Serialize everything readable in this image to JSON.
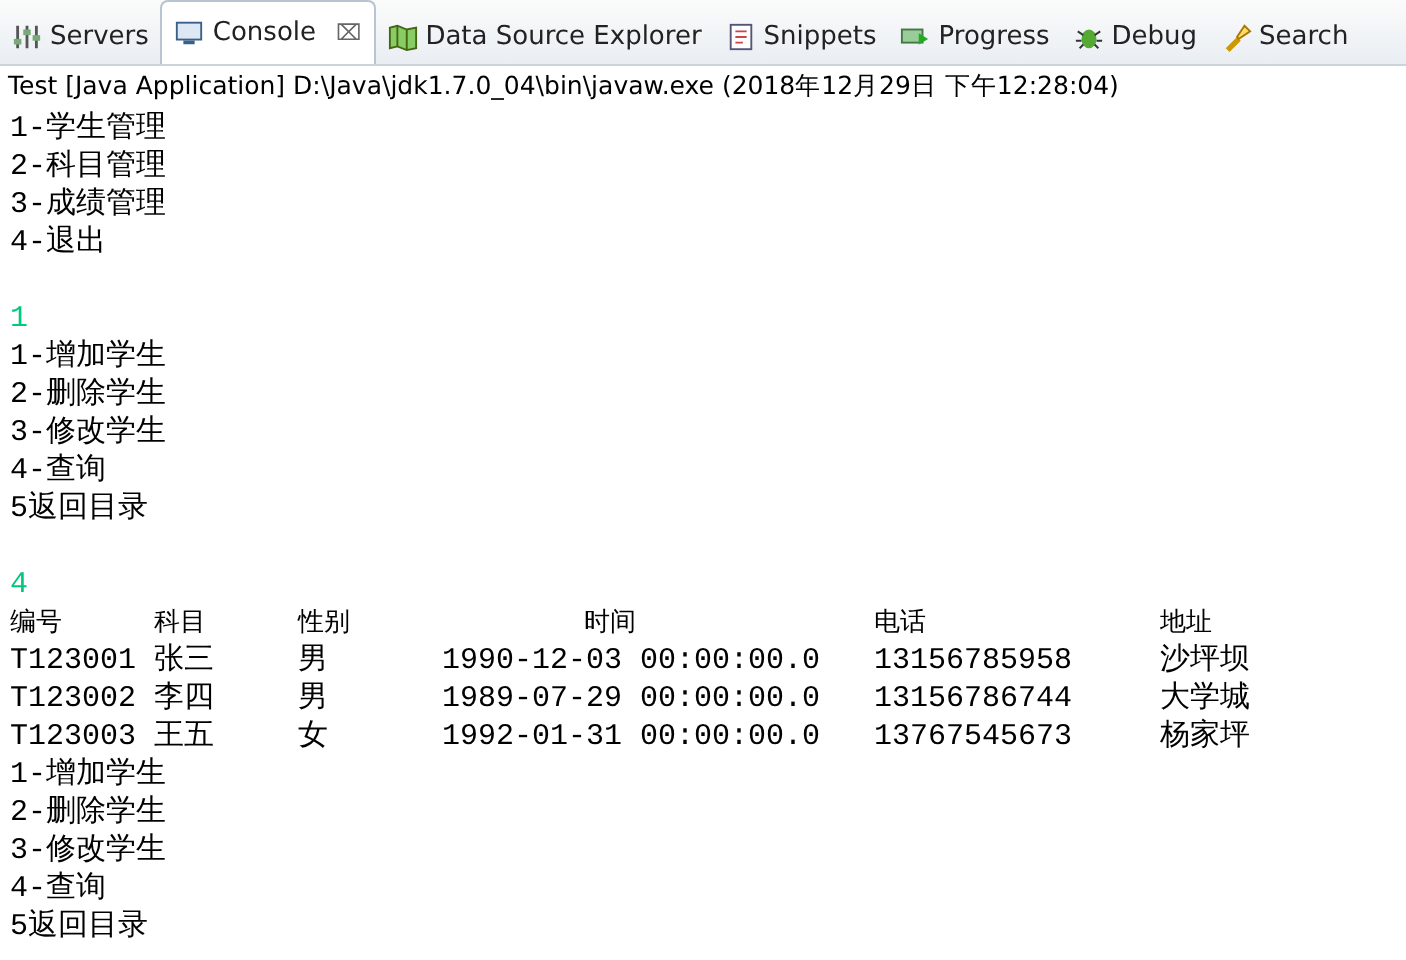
{
  "tabs": [
    {
      "label": "Servers",
      "kind": "servers",
      "selected": false
    },
    {
      "label": "Console",
      "kind": "console",
      "selected": true,
      "close": "⌧"
    },
    {
      "label": "Data Source Explorer",
      "kind": "datasource",
      "selected": false
    },
    {
      "label": "Snippets",
      "kind": "snippets",
      "selected": false
    },
    {
      "label": "Progress",
      "kind": "progress",
      "selected": false
    },
    {
      "label": "Debug",
      "kind": "debug",
      "selected": false
    },
    {
      "label": "Search",
      "kind": "search",
      "selected": false
    }
  ],
  "console_title": "Test [Java Application] D:\\Java\\jdk1.7.0_04\\bin\\javaw.exe (2018年12月29日 下午12:28:04)",
  "lines": [
    {
      "kind": "output",
      "text": "1-学生管理"
    },
    {
      "kind": "output",
      "text": "2-科目管理"
    },
    {
      "kind": "output",
      "text": "3-成绩管理"
    },
    {
      "kind": "output",
      "text": "4-退出"
    },
    {
      "kind": "blank"
    },
    {
      "kind": "input",
      "text": "1"
    },
    {
      "kind": "output",
      "text": "1-增加学生"
    },
    {
      "kind": "output",
      "text": "2-删除学生"
    },
    {
      "kind": "output",
      "text": "3-修改学生"
    },
    {
      "kind": "output",
      "text": "4-查询"
    },
    {
      "kind": "output",
      "text": "5返回目录"
    },
    {
      "kind": "blank"
    },
    {
      "kind": "input",
      "text": "4"
    },
    {
      "kind": "header",
      "cells": [
        "编号",
        "科目",
        "性别",
        "时间",
        "电话",
        "地址"
      ]
    },
    {
      "kind": "row",
      "cells": [
        "T123001",
        "张三",
        "男",
        "1990-12-03 00:00:00.0",
        "13156785958",
        "沙坪坝"
      ]
    },
    {
      "kind": "row",
      "cells": [
        "T123002",
        "李四",
        "男",
        "1989-07-29 00:00:00.0",
        "13156786744",
        "大学城"
      ]
    },
    {
      "kind": "row",
      "cells": [
        "T123003",
        "王五",
        "女",
        "1992-01-31 00:00:00.0",
        "13767545673",
        "杨家坪"
      ]
    },
    {
      "kind": "output",
      "text": "1-增加学生"
    },
    {
      "kind": "output",
      "text": "2-删除学生"
    },
    {
      "kind": "output",
      "text": "3-修改学生"
    },
    {
      "kind": "output",
      "text": "4-查询"
    },
    {
      "kind": "output",
      "text": "5返回目录"
    }
  ]
}
